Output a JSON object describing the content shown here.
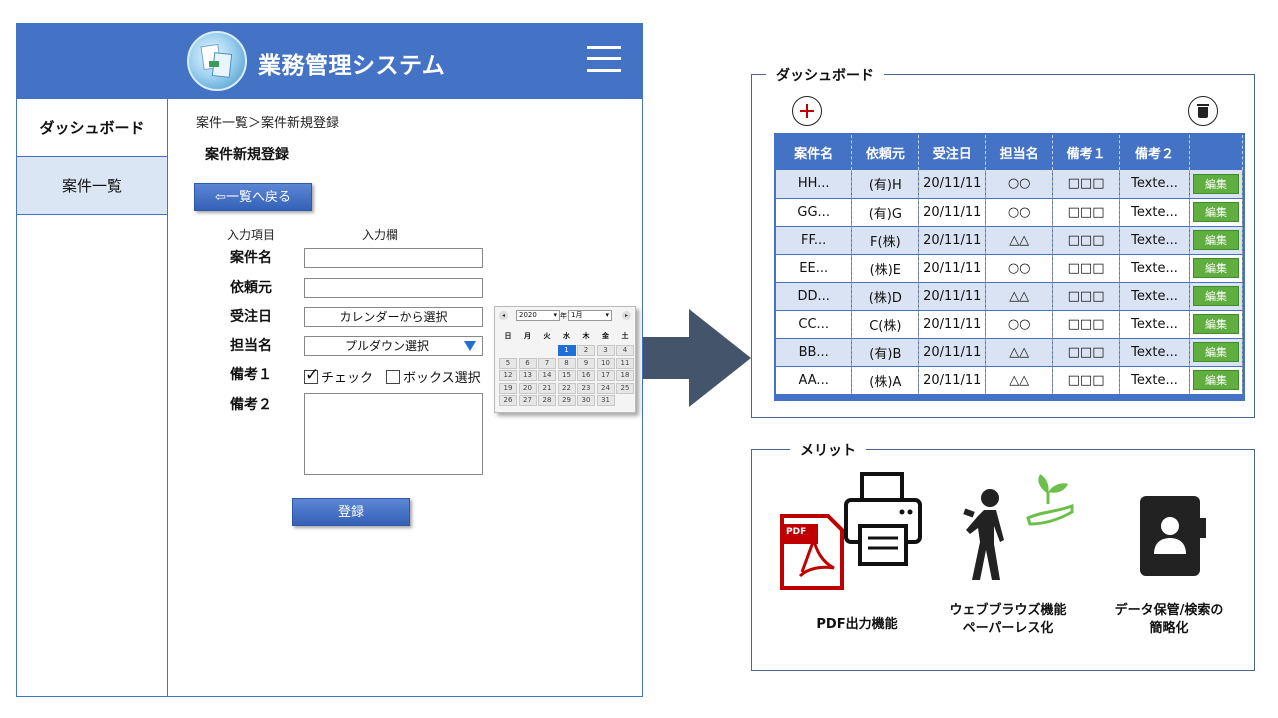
{
  "app": {
    "title": "業務管理システム",
    "sidebar": {
      "items": [
        {
          "label": "ダッシュボード"
        },
        {
          "label": "案件一覧"
        }
      ]
    },
    "breadcrumb": "案件一覧＞案件新規登録",
    "page_title": "案件新規登録",
    "back_button": "⇦一覧へ戻る",
    "form": {
      "col_item": "入力項目",
      "col_input": "入力欄",
      "labels": [
        "案件名",
        "依頼元",
        "受注日",
        "担当名",
        "備考１",
        "備考２"
      ],
      "date_placeholder": "カレンダーから選択",
      "select_value": "プルダウン選択",
      "checkbox_checked_label": "チェック",
      "checkbox_unchecked_label": "ボックス選択",
      "submit_button": "登録"
    },
    "calendar": {
      "year": "2020",
      "year_unit": "年",
      "month": "1月",
      "weekdays": [
        "日",
        "月",
        "火",
        "水",
        "木",
        "金",
        "土"
      ],
      "selected_day": "1",
      "days": [
        "1",
        "2",
        "3",
        "4",
        "5",
        "6",
        "7",
        "8",
        "9",
        "10",
        "11",
        "12",
        "13",
        "14",
        "15",
        "16",
        "17",
        "18",
        "19",
        "20",
        "21",
        "22",
        "23",
        "24",
        "25",
        "26",
        "27",
        "28",
        "29",
        "30",
        "31"
      ],
      "first_weekday_index": 3
    }
  },
  "dashboard": {
    "title": "ダッシュボード",
    "columns": [
      "案件名",
      "依頼元",
      "受注日",
      "担当名",
      "備考１",
      "備考２",
      ""
    ],
    "edit_label": "編集",
    "rows": [
      [
        "HH...",
        "(有)H",
        "20/11/11",
        "○○",
        "□□□",
        "Texte..."
      ],
      [
        "GG...",
        "(有)G",
        "20/11/11",
        "○○",
        "□□□",
        "Texte..."
      ],
      [
        "FF...",
        "F(株)",
        "20/11/11",
        "△△",
        "□□□",
        "Texte..."
      ],
      [
        "EE...",
        "(株)E",
        "20/11/11",
        "○○",
        "□□□",
        "Texte..."
      ],
      [
        "DD...",
        "(株)D",
        "20/11/11",
        "△△",
        "□□□",
        "Texte..."
      ],
      [
        "CC...",
        "C(株)",
        "20/11/11",
        "○○",
        "□□□",
        "Texte..."
      ],
      [
        "BB...",
        "(有)B",
        "20/11/11",
        "△△",
        "□□□",
        "Texte..."
      ],
      [
        "AA...",
        "(株)A",
        "20/11/11",
        "△△",
        "□□□",
        "Texte..."
      ]
    ]
  },
  "merit": {
    "title": "メリット",
    "items": [
      {
        "label": "PDF出力機能",
        "icon": "pdf-printer-icon",
        "badge": "PDF"
      },
      {
        "label_line1": "ウェブブラウズ機能",
        "label_line2": "ペーパーレス化",
        "icon": "paperless-person-icon"
      },
      {
        "label_line1": "データ保管/検索の",
        "label_line2": "簡略化",
        "icon": "contact-book-icon"
      }
    ]
  },
  "colors": {
    "header_blue": "#4472c4",
    "sidebar_active": "#dae6f4",
    "edit_green": "#5fae3f",
    "arrow": "#44546a",
    "pdf_red": "#c00000"
  }
}
